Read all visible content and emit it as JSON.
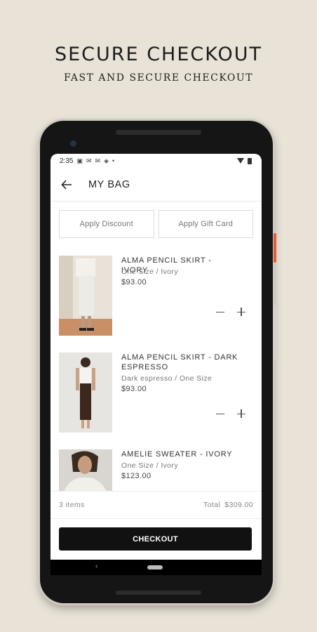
{
  "promo": {
    "title": "SECURE CHECKOUT",
    "subtitle": "FAST AND SECURE CHECKOUT"
  },
  "status_bar": {
    "time": "2:35"
  },
  "header": {
    "title": "MY BAG",
    "back_icon": "arrow-left-icon"
  },
  "actions": {
    "apply_discount": "Apply Discount",
    "apply_gift_card": "Apply Gift Card"
  },
  "items": [
    {
      "name": "ALMA PENCIL SKIRT - IVORY",
      "variant": "One Size / Ivory",
      "price": "$93.00"
    },
    {
      "name": "ALMA PENCIL SKIRT - DARK ESPRESSO",
      "variant": "Dark espresso / One Size",
      "price": "$93.00"
    },
    {
      "name": "AMELIE SWEATER - IVORY",
      "variant": "One Size / Ivory",
      "price": "$123.00"
    }
  ],
  "summary": {
    "count": "3 items",
    "total_label": "Total",
    "total_value": "$309.00"
  },
  "checkout": {
    "label": "CHECKOUT"
  },
  "colors": {
    "background": "#e8e2d7",
    "checkout_button": "#111111",
    "accent_side_button": "#e05b3c"
  }
}
